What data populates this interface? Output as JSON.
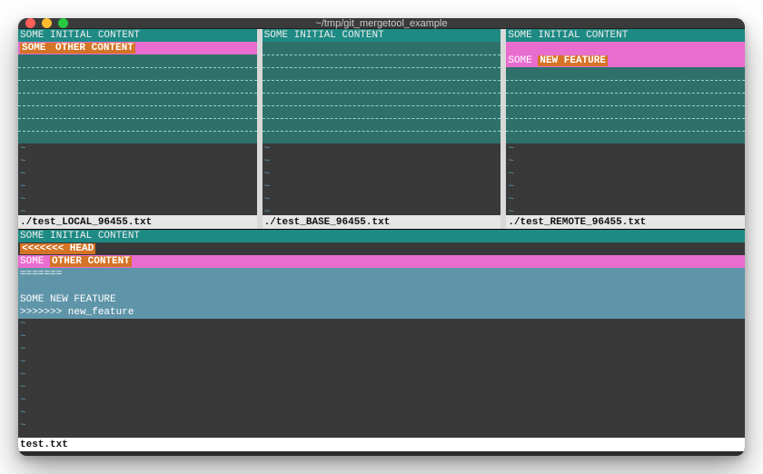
{
  "window": {
    "title": "~/tmp/git_mergetool_example"
  },
  "colors": {
    "pink": "#e86dcf",
    "orange": "#d47426",
    "teal": "#1e8a84",
    "blue": "#5f95a9",
    "editor_bg": "#393939"
  },
  "top_panes": [
    {
      "status": "./test_LOCAL_96455.txt",
      "lines": [
        {
          "style": "teal",
          "segments": [
            {
              "text": "SOME INITIAL CONTENT"
            }
          ]
        },
        {
          "style": "pink",
          "segments": [
            {
              "text": "SOME ",
              "hl": "orange"
            },
            {
              "text": "OTHER CONTENT",
              "hl": "orange-bold"
            }
          ]
        }
      ],
      "filler_rows": 7,
      "tildes": 6
    },
    {
      "status": "./test_BASE_96455.txt",
      "lines": [
        {
          "style": "teal",
          "segments": [
            {
              "text": "SOME INITIAL CONTENT"
            }
          ]
        }
      ],
      "filler_rows": 8,
      "tildes": 6
    },
    {
      "status": "./test_REMOTE_96455.txt",
      "lines": [
        {
          "style": "teal",
          "segments": [
            {
              "text": "SOME INITIAL CONTENT"
            }
          ]
        },
        {
          "style": "pink",
          "segments": [
            {
              "text": ""
            }
          ]
        },
        {
          "style": "pink",
          "segments": [
            {
              "text": "SOME "
            },
            {
              "text": "NEW FEATURE",
              "hl": "orange-bold"
            }
          ]
        }
      ],
      "filler_rows": 6,
      "tildes": 6
    }
  ],
  "bottom_pane": {
    "status": "test.txt",
    "lines": [
      {
        "style": "teal",
        "segments": [
          {
            "text": "SOME INITIAL CONTENT"
          }
        ]
      },
      {
        "style": "plain",
        "segments": [
          {
            "text": "<<<<<<< HEAD",
            "hl": "orange-bold"
          }
        ]
      },
      {
        "style": "pink",
        "segments": [
          {
            "text": "SOME "
          },
          {
            "text": "OTHER CONTENT",
            "hl": "orange-bold"
          }
        ]
      },
      {
        "style": "blue",
        "segments": [
          {
            "text": "======="
          }
        ]
      },
      {
        "style": "blue",
        "segments": [
          {
            "text": ""
          }
        ]
      },
      {
        "style": "blue",
        "segments": [
          {
            "text": "SOME NEW FEATURE"
          }
        ]
      },
      {
        "style": "blue",
        "segments": [
          {
            "text": ">>>>>>> new_feature"
          }
        ]
      }
    ],
    "tildes": 9
  }
}
